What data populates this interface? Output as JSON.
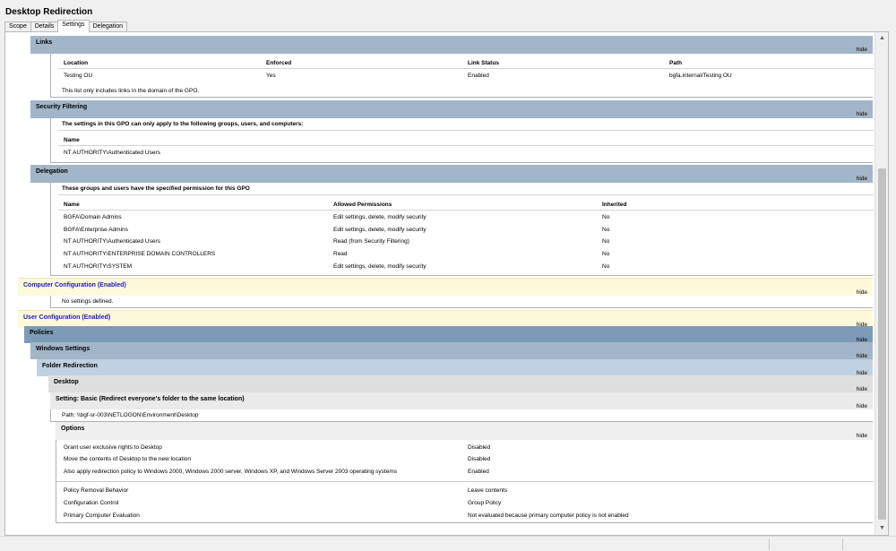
{
  "window": {
    "title": "Desktop Redirection"
  },
  "tabs": [
    "Scope",
    "Details",
    "Settings",
    "Delegation"
  ],
  "hide_label": "hide",
  "links": {
    "title": "Links",
    "headers": [
      "Location",
      "Enforced",
      "Link Status",
      "Path"
    ],
    "rows": [
      [
        "Testing OU",
        "Yes",
        "Enabled",
        "bgfa.internal/Testing OU"
      ]
    ],
    "note": "This list only includes links in the domain of the GPO."
  },
  "security": {
    "title": "Security Filtering",
    "description": "The settings in this GPO can only apply to the following groups, users, and computers:",
    "header": "Name",
    "rows": [
      "NT AUTHORITY\\Authenticated Users"
    ]
  },
  "delegation": {
    "title": "Delegation",
    "description": "These groups and users have the specified permission for this GPO",
    "headers": [
      "Name",
      "Allowed Permissions",
      "Inherited"
    ],
    "rows": [
      [
        "BGFA\\Domain Admins",
        "Edit settings, delete, modify security",
        "No"
      ],
      [
        "BGFA\\Enterprise Admins",
        "Edit settings, delete, modify security",
        "No"
      ],
      [
        "NT AUTHORITY\\Authenticated Users",
        "Read (from Security Filtering)",
        "No"
      ],
      [
        "NT AUTHORITY\\ENTERPRISE DOMAIN CONTROLLERS",
        "Read",
        "No"
      ],
      [
        "NT AUTHORITY\\SYSTEM",
        "Edit settings, delete, modify security",
        "No"
      ]
    ]
  },
  "computer_config": {
    "title": "Computer Configuration (Enabled)",
    "note": "No settings defined."
  },
  "user_config": {
    "title": "User Configuration (Enabled)",
    "policies": "Policies",
    "windows_settings": "Windows Settings",
    "folder_redirection": "Folder Redirection",
    "desktop": "Desktop",
    "setting": "Setting: Basic (Redirect everyone's folder to the same location)",
    "path": "Path: \\\\bgf-sr-003\\NETLOGON\\Environment\\Desktop",
    "options_title": "Options",
    "options": [
      [
        "Grant user exclusive rights to Desktop",
        "Disabled"
      ],
      [
        "Move the contents of Desktop to the new location",
        "Disabled"
      ],
      [
        "Also apply redirection policy to Windows 2000, Windows 2000 server, Windows XP, and Windows Server 2003 operating systems",
        "Enabled"
      ]
    ],
    "policy_rows": [
      [
        "Policy Removal Behavior",
        "Leave contents"
      ],
      [
        "Configuration Control",
        "Group Policy"
      ],
      [
        "Primary Computer Evaluation",
        "Not evaluated because primary computer policy is not enabled"
      ]
    ]
  },
  "colors": {
    "section_header": "#a3b6c8",
    "config_header": "#fff9dc",
    "config_text": "#1a1ab0",
    "policies_header": "#7d9bb6"
  }
}
